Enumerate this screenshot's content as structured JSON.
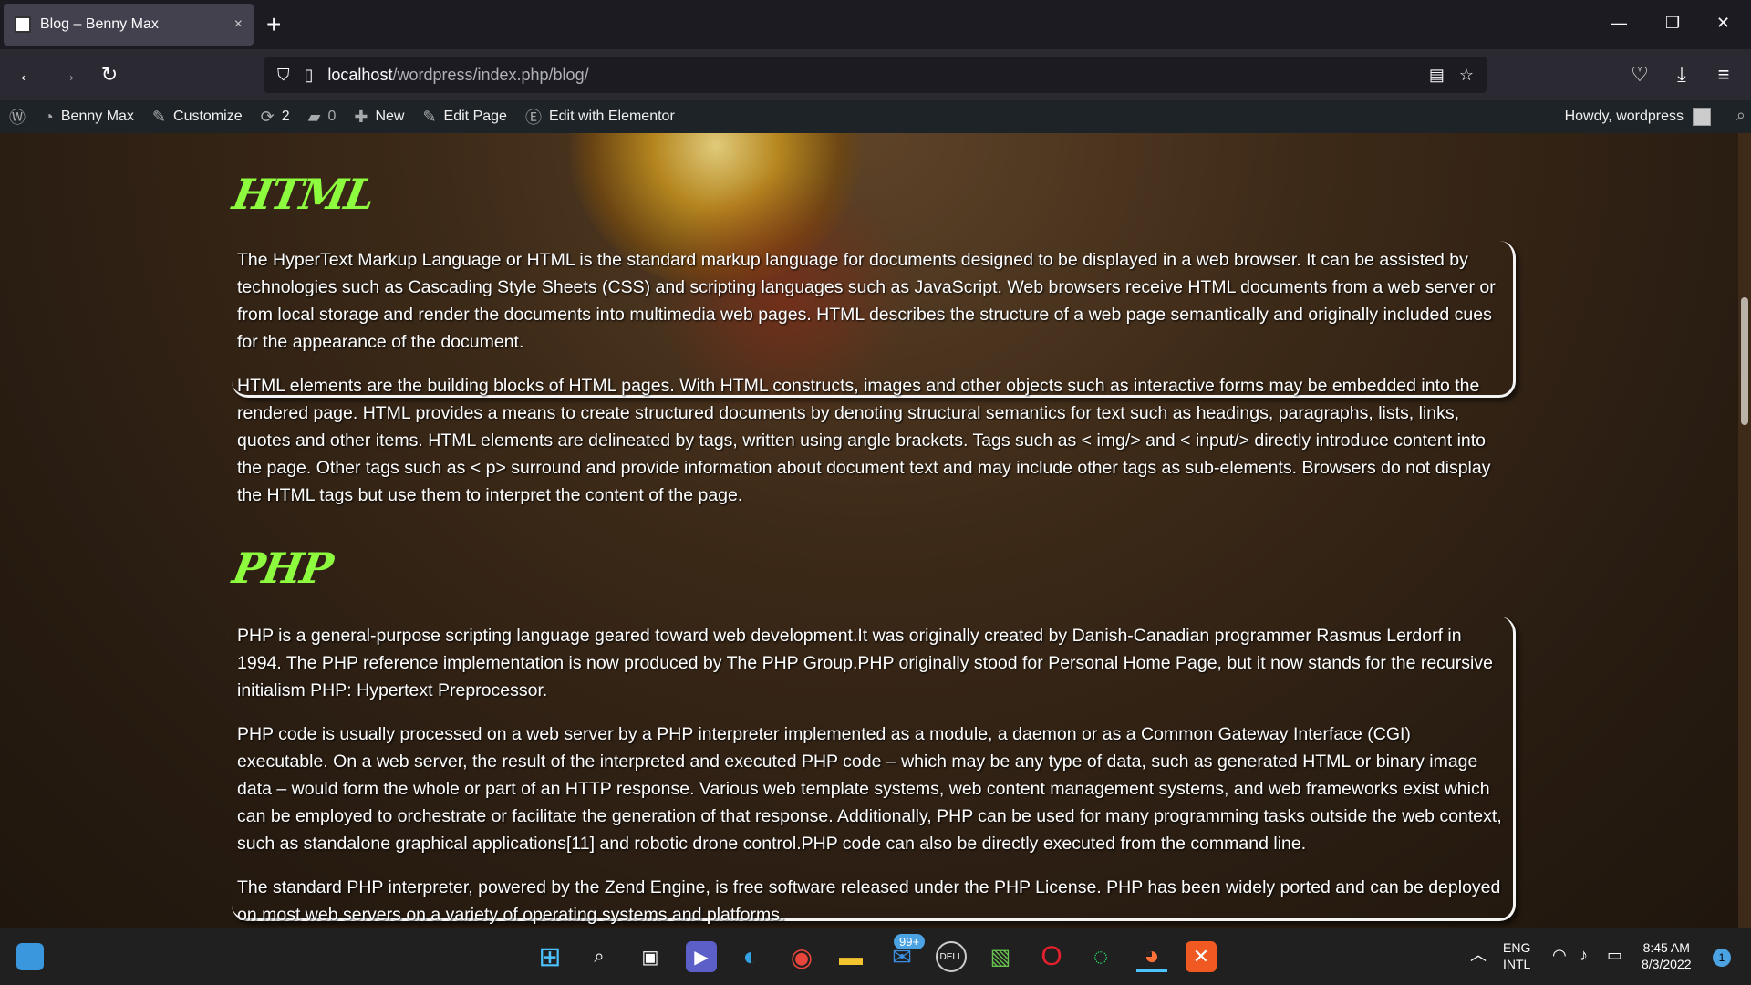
{
  "browser": {
    "tab_title": "Blog – Benny Max",
    "tab_close": "×",
    "new_tab": "+",
    "url_host": "localhost",
    "url_path": "/wordpress/index.php/blog/",
    "minimize": "—",
    "restore": "❐",
    "close": "✕"
  },
  "adminbar": {
    "site_name": "Benny Max",
    "customize": "Customize",
    "updates_count": "2",
    "comments_count": "0",
    "new_label": "New",
    "edit_page": "Edit Page",
    "edit_elementor": "Edit with Elementor",
    "howdy": "Howdy, wordpress"
  },
  "content": {
    "sections": [
      {
        "title": "HTML",
        "paragraphs": [
          "The HyperText Markup Language or HTML is the standard markup language for documents designed to be displayed in a web browser. It can be assisted by technologies such as Cascading Style Sheets (CSS) and scripting languages such as JavaScript. Web browsers receive HTML documents from a web server or from local storage and render the documents into multimedia web pages. HTML describes the structure of a web page semantically and originally included cues for the appearance of the document.",
          "HTML elements are the building blocks of HTML pages. With HTML constructs, images and other objects such as interactive forms may be embedded into the rendered page. HTML provides a means to create structured documents by denoting structural semantics for text such as headings, paragraphs, lists, links, quotes and other items. HTML elements are delineated by tags, written using angle brackets. Tags such as < img/> and < input/> directly introduce content into the page. Other tags such as < p> surround and provide information about document text and may include other tags as sub-elements. Browsers do not display the HTML tags but use them to interpret the content of the page."
        ]
      },
      {
        "title": "PHP",
        "paragraphs": [
          "PHP is a general-purpose scripting language geared toward web development.It was originally created by Danish-Canadian programmer Rasmus Lerdorf in 1994. The PHP reference implementation is now produced by The PHP Group.PHP originally stood for Personal Home Page, but it now stands for the recursive initialism PHP: Hypertext Preprocessor.",
          "PHP code is usually processed on a web server by a PHP interpreter implemented as a module, a daemon or as a Common Gateway Interface (CGI) executable. On a web server, the result of the interpreted and executed PHP code – which may be any type of data, such as generated HTML or binary image data – would form the whole or part of an HTTP response. Various web template systems, web content management systems, and web frameworks exist which can be employed to orchestrate or facilitate the generation of that response. Additionally, PHP can be used for many programming tasks outside the web context, such as standalone graphical applications[11] and robotic drone control.PHP code can also be directly executed from the command line.",
          "The standard PHP interpreter, powered by the Zend Engine, is free software released under the PHP License. PHP has been widely ported and can be deployed on most web servers on a variety of operating systems and platforms."
        ]
      }
    ]
  },
  "taskbar": {
    "mail_badge": "99+",
    "lang_line1": "ENG",
    "lang_line2": "INTL",
    "time": "8:45 AM",
    "date": "8/3/2022",
    "notification_count": "1"
  },
  "colors": {
    "heading_green": "#8dfc3e",
    "adminbar_bg": "#1d2327",
    "page_bg": "#3d2a18"
  }
}
